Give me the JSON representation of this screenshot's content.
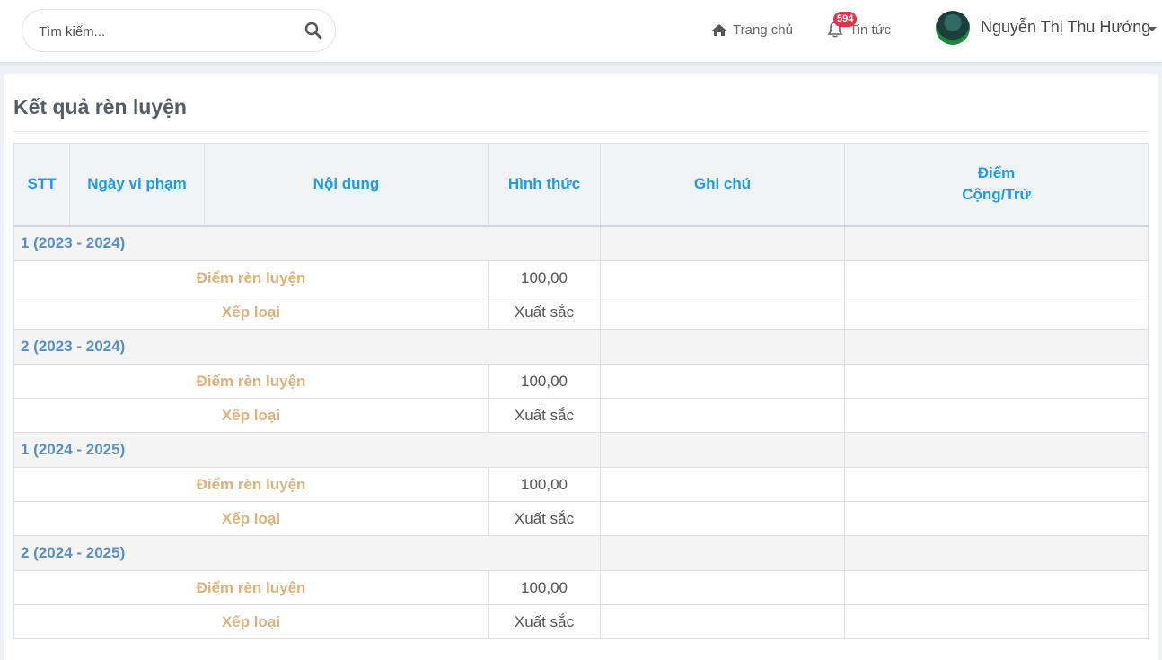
{
  "header": {
    "search_placeholder": "Tìm kiếm...",
    "nav_home": "Trang chủ",
    "nav_news": "Tin tức",
    "news_badge": "594",
    "user_name": "Nguyễn Thị Thu Hướng"
  },
  "page": {
    "title": "Kết quả rèn luyện"
  },
  "table": {
    "columns": [
      "STT",
      "Ngày vi phạm",
      "Nội dung",
      "Hình thức",
      "Ghi chú",
      "Điểm Cộng/Trừ"
    ],
    "groups": [
      {
        "label": "1 (2023 - 2024)",
        "rows": [
          {
            "label": "Điểm rèn luyện",
            "value": "100,00"
          },
          {
            "label": "Xếp loại",
            "value": "Xuất sắc"
          }
        ]
      },
      {
        "label": "2 (2023 - 2024)",
        "rows": [
          {
            "label": "Điểm rèn luyện",
            "value": "100,00"
          },
          {
            "label": "Xếp loại",
            "value": "Xuất sắc"
          }
        ]
      },
      {
        "label": "1 (2024 - 2025)",
        "rows": [
          {
            "label": "Điểm rèn luyện",
            "value": "100,00"
          },
          {
            "label": "Xếp loại",
            "value": "Xuất sắc"
          }
        ]
      },
      {
        "label": "2 (2024 - 2025)",
        "rows": [
          {
            "label": "Điểm rèn luyện",
            "value": "100,00"
          },
          {
            "label": "Xếp loại",
            "value": "Xuất sắc"
          }
        ]
      }
    ]
  },
  "colors": {
    "header_text": "#1e9be6",
    "group_text": "#5a8fc0",
    "item_label": "#dbb27e",
    "badge": "#e8314b"
  }
}
